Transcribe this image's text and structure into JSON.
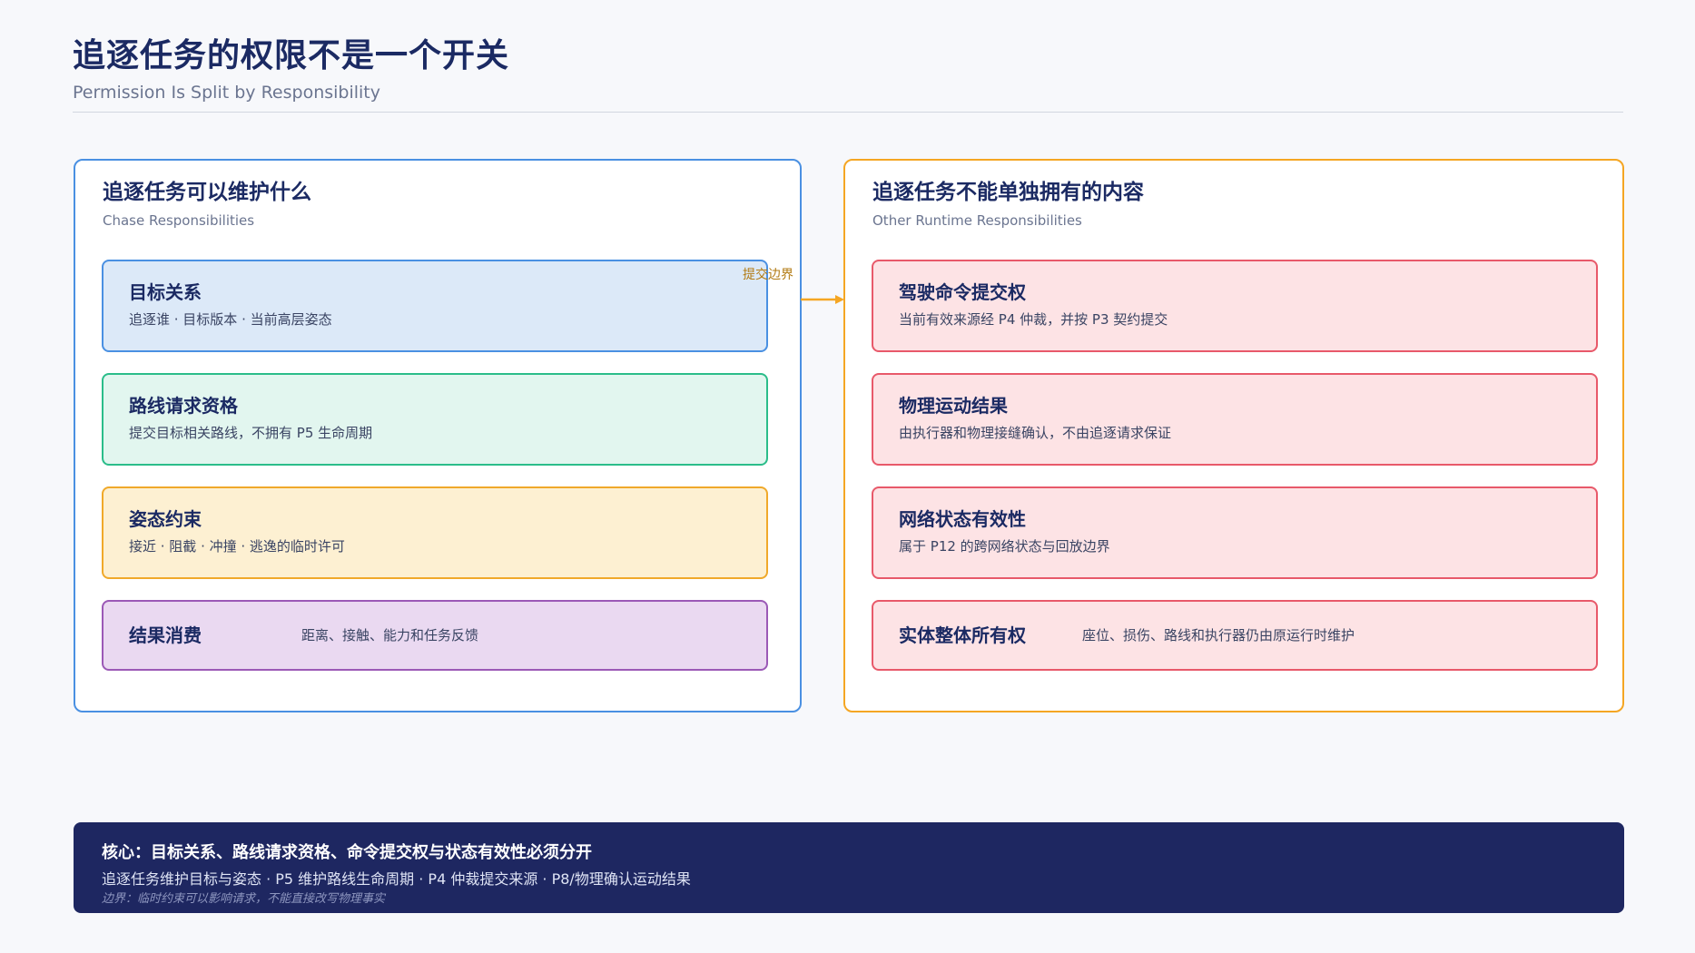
{
  "header": {
    "title": "追逐任务的权限不是一个开关",
    "subtitle": "Permission Is Split by Responsibility"
  },
  "left_panel": {
    "title": "追逐任务可以维护什么",
    "subtitle": "Chase Responsibilities",
    "border_color": "#4a90e2",
    "cards": [
      {
        "title": "目标关系",
        "desc": "追逐谁 · 目标版本 · 当前高层姿态",
        "color": "#dce9f8"
      },
      {
        "title": "路线请求资格",
        "desc": "提交目标相关路线，不拥有 P5 生命周期",
        "color": "#e2f6ef"
      },
      {
        "title": "姿态约束",
        "desc": "接近 · 阻截 · 冲撞 · 逃逸的临时许可",
        "color": "#fdf0d2"
      },
      {
        "title": "结果消费",
        "desc": "距离、接触、能力和任务反馈",
        "color": "#ead9f1"
      }
    ]
  },
  "right_panel": {
    "title": "追逐任务不能单独拥有的内容",
    "subtitle": "Other Runtime Responsibilities",
    "border_color": "#f5a623",
    "cards": [
      {
        "title": "驾驶命令提交权",
        "desc": "当前有效来源经 P4 仲裁，并按 P3 契约提交",
        "color": "#fde3e5"
      },
      {
        "title": "物理运动结果",
        "desc": "由执行器和物理接缝确认，不由追逐请求保证",
        "color": "#fde3e5"
      },
      {
        "title": "网络状态有效性",
        "desc": "属于 P12 的跨网络状态与回放边界",
        "color": "#fde3e5"
      },
      {
        "title": "实体整体所有权",
        "desc": "座位、损伤、路线和执行器仍由原运行时维护",
        "color": "#fde3e5"
      }
    ]
  },
  "boundary": {
    "label": "提交边界",
    "color": "#f5a623"
  },
  "footer": {
    "title": "核心：目标关系、路线请求资格、命令提交权与状态有效性必须分开",
    "line": "追逐任务维护目标与姿态 · P5 维护路线生命周期 · P4 仲裁提交来源 · P8/物理确认运动结果",
    "note": "边界：临时约束可以影响请求，不能直接改写物理事实",
    "background": "#1e2761"
  }
}
